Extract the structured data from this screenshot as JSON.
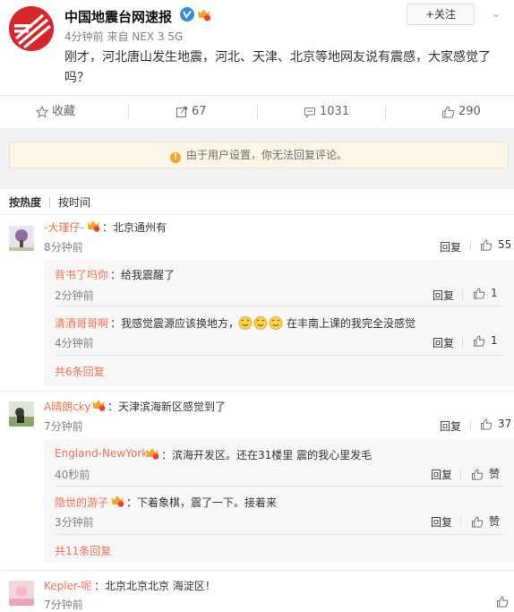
{
  "post": {
    "author": "中国地震台网速报",
    "meta": "4分钟前 来自 NEX 3 5G",
    "follow_label": "+关注",
    "text": "刚才，河北唐山发生地震，河北、天津、北京等地网友说有震感，大家感觉了吗？"
  },
  "actions": {
    "favorite": "收藏",
    "repost": "67",
    "comments": "1031",
    "likes": "290"
  },
  "notice": "由于用户设置，你无法回复评论。",
  "sort": {
    "hot": "按热度",
    "time": "按时间"
  },
  "labels": {
    "reply": "回复",
    "praise": "赞"
  },
  "comments": [
    {
      "name": "-大瑾仔-",
      "text": "：北京通州有",
      "time": "8分钟前",
      "likes": "55",
      "replies": [
        {
          "name": "背书了吗你",
          "text": "：给我震醒了",
          "time": "2分钟前",
          "likes": "1"
        },
        {
          "name": "清酒哥哥啊",
          "text_before": "：我感觉震源应该换地方，",
          "text_after": "在丰南上课的我完全没感觉",
          "time": "4分钟前",
          "likes": "1"
        }
      ],
      "more": "共6条回复"
    },
    {
      "name": "A晴朗cky",
      "text": "：天津滨海新区感觉到了",
      "time": "7分钟前",
      "likes": "37",
      "replies": [
        {
          "name": "England-NewYork",
          "text": "：滨海开发区。还在31楼里 震的我心里发毛",
          "time": "40秒前",
          "likes": "赞"
        },
        {
          "name": "隐世的游子",
          "text": "：下着象棋，震了一下。接着来",
          "time": "3分钟前",
          "likes": "赞"
        }
      ],
      "more": "共11条回复"
    },
    {
      "name": "Kepler-呢",
      "text": "：北京北京北京 海淀区！",
      "time": "7分钟前"
    }
  ]
}
